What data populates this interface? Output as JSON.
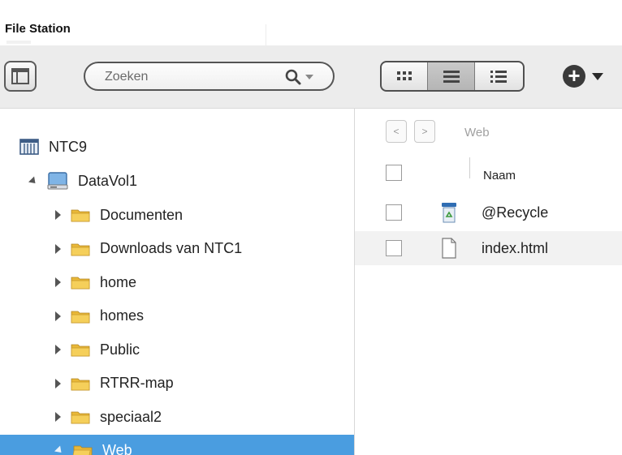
{
  "window": {
    "title": "File Station"
  },
  "toolbar": {
    "search_placeholder": "Zoeken",
    "view_modes": [
      "thumbnail-view",
      "list-view",
      "detail-view"
    ],
    "active_view": "list-view"
  },
  "sidebar": {
    "root": {
      "label": "NTC9",
      "icon": "nas-icon"
    },
    "volume": {
      "label": "DataVol1",
      "icon": "disk-icon",
      "expanded": true
    },
    "folders": [
      {
        "label": "Documenten",
        "expanded": false
      },
      {
        "label": "Downloads van NTC1",
        "expanded": false
      },
      {
        "label": "home",
        "expanded": false
      },
      {
        "label": "homes",
        "expanded": false
      },
      {
        "label": "Public",
        "expanded": false
      },
      {
        "label": "RTRR-map",
        "expanded": false
      },
      {
        "label": "speciaal2",
        "expanded": false
      },
      {
        "label": "Web",
        "expanded": true,
        "selected": true
      }
    ],
    "selected_color": "#4a9de0"
  },
  "main": {
    "breadcrumb": "Web",
    "nav": {
      "back": "<",
      "forward": ">"
    },
    "columns": {
      "name": "Naam"
    },
    "files": [
      {
        "name": "@Recycle",
        "icon": "recycle-bin-icon"
      },
      {
        "name": "index.html",
        "icon": "file-icon"
      }
    ]
  },
  "colors": {
    "folder": "#f5cf5a",
    "accent": "#4a9de0",
    "toolbar": "#ececec"
  }
}
